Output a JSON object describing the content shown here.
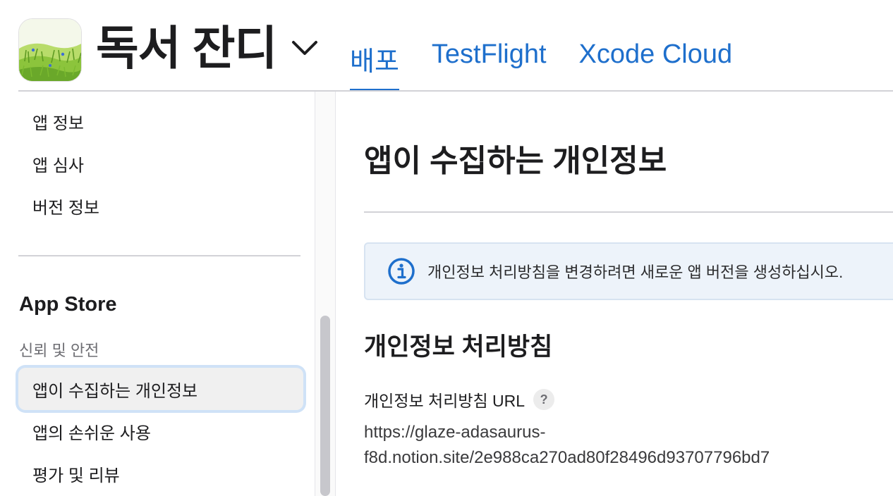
{
  "header": {
    "app_name": "독서 잔디",
    "tabs": [
      {
        "label": "배포",
        "active": true
      },
      {
        "label": "TestFlight",
        "active": false
      },
      {
        "label": "Xcode Cloud",
        "active": false
      }
    ]
  },
  "sidebar": {
    "items_top": [
      {
        "label": "앱 정보"
      },
      {
        "label": "앱 심사"
      },
      {
        "label": "버전 정보"
      }
    ],
    "section_title": "App Store",
    "subsection_title": "신뢰 및 안전",
    "items_store": [
      {
        "label": "앱이 수집하는 개인정보",
        "selected": true
      },
      {
        "label": "앱의 손쉬운 사용"
      },
      {
        "label": "평가 및 리뷰"
      }
    ]
  },
  "main": {
    "title": "앱이 수집하는 개인정보",
    "notice": "개인정보 처리방침을 변경하려면 새로운 앱 버전을 생성하십시오.",
    "section_title": "개인정보 처리방침",
    "field_label": "개인정보 처리방침 URL",
    "help_glyph": "?",
    "url_line1": "https://glaze-adasaurus-",
    "url_line2": "f8d.notion.site/2e988ca270ad80f28496d93707796bd7"
  },
  "colors": {
    "accent": "#1e6fcc",
    "notice_bg": "#edf3fa",
    "selected_ring": "#cfe2f7"
  }
}
